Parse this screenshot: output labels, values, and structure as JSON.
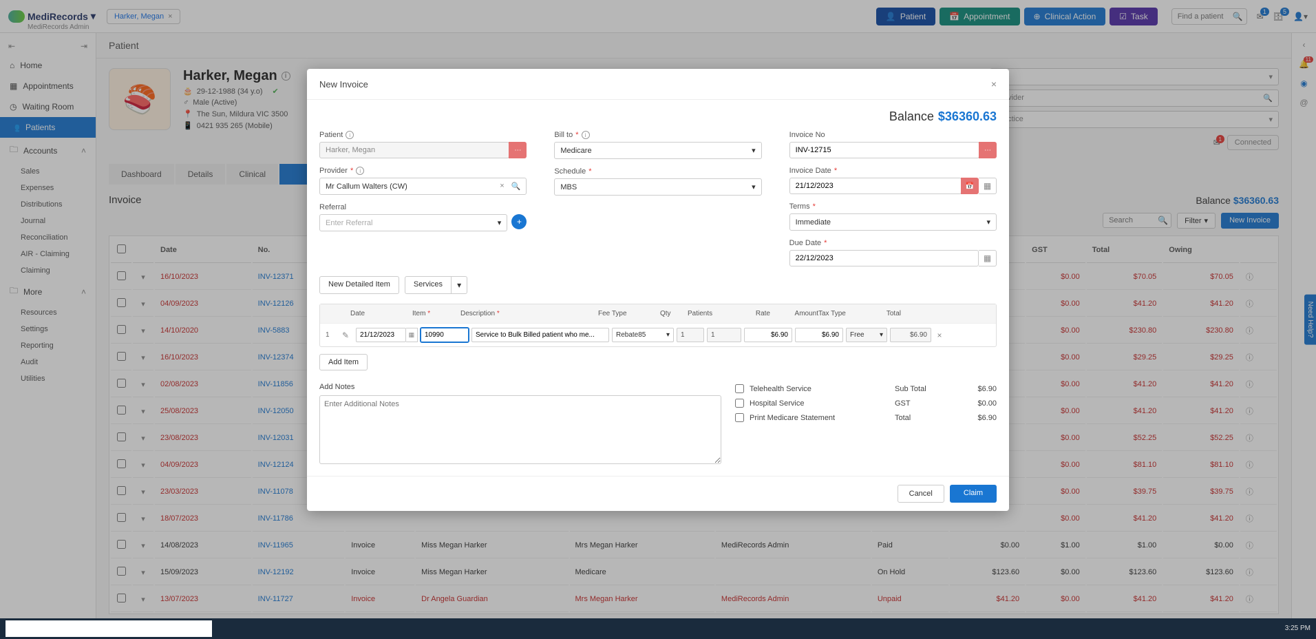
{
  "app": {
    "name": "MediRecords",
    "sub": "MediRecords Admin"
  },
  "patient_tab": "Harker, Megan",
  "top_buttons": {
    "patient": "Patient",
    "appointment": "Appointment",
    "clinical": "Clinical Action",
    "task": "Task"
  },
  "search_placeholder": "Find a patient",
  "badges": {
    "mail": "1",
    "box": "5",
    "rail": "11",
    "mailred": "1"
  },
  "sidebar": {
    "items": [
      {
        "label": "Home",
        "icon": "home"
      },
      {
        "label": "Appointments",
        "icon": "calendar"
      },
      {
        "label": "Waiting Room",
        "icon": "clock"
      },
      {
        "label": "Patients",
        "icon": "users",
        "active": true
      },
      {
        "label": "Accounts",
        "icon": "folder",
        "expand": true
      },
      {
        "label": "More",
        "icon": "folder",
        "expand": true
      }
    ],
    "accounts_sub": [
      "Sales",
      "Expenses",
      "Distributions",
      "Journal",
      "Reconciliation",
      "AIR - Claiming",
      "Claiming"
    ],
    "more_sub": [
      "Resources",
      "Settings",
      "Reporting",
      "Audit",
      "Utilities"
    ]
  },
  "page_title": "Patient",
  "patient": {
    "name": "Harker, Megan",
    "dob": "29-12-1988 (34 y.o)",
    "gender": "Male (Active)",
    "address": "The Sun, Mildura VIC 3500",
    "phone": "0421 935 265 (Mobile)"
  },
  "right_selects": {
    "a": "",
    "a_hint": "...rd",
    "b": "Provider",
    "c": "Practice"
  },
  "connected": "Connected",
  "tabs": [
    "Dashboard",
    "Details",
    "Clinical"
  ],
  "invoice": {
    "title": "Invoice",
    "balance_label": "Balance",
    "balance": "$36360.63",
    "search_ph": "Search",
    "filter": "Filter",
    "new": "New Invoice",
    "headers": [
      "Date",
      "No.",
      "",
      "",
      "",
      "",
      "",
      "",
      "GST",
      "Total",
      "Owing"
    ],
    "rows": [
      {
        "date": "16/10/2023",
        "no": "INV-12371",
        "gst": "$0.00",
        "total": "$70.05",
        "owing": "$70.05",
        "red": true
      },
      {
        "date": "04/09/2023",
        "no": "INV-12126",
        "gst": "$0.00",
        "total": "$41.20",
        "owing": "$41.20",
        "red": true
      },
      {
        "date": "14/10/2020",
        "no": "INV-5883",
        "gst": "$0.00",
        "total": "$230.80",
        "owing": "$230.80",
        "red": true
      },
      {
        "date": "16/10/2023",
        "no": "INV-12374",
        "gst": "$0.00",
        "total": "$29.25",
        "owing": "$29.25",
        "red": true
      },
      {
        "date": "02/08/2023",
        "no": "INV-11856",
        "gst": "$0.00",
        "total": "$41.20",
        "owing": "$41.20",
        "red": true
      },
      {
        "date": "25/08/2023",
        "no": "INV-12050",
        "gst": "$0.00",
        "total": "$41.20",
        "owing": "$41.20",
        "red": true
      },
      {
        "date": "23/08/2023",
        "no": "INV-12031",
        "gst": "$0.00",
        "total": "$52.25",
        "owing": "$52.25",
        "red": true
      },
      {
        "date": "04/09/2023",
        "no": "INV-12124",
        "gst": "$0.00",
        "total": "$81.10",
        "owing": "$81.10",
        "red": true
      },
      {
        "date": "23/03/2023",
        "no": "INV-11078",
        "gst": "$0.00",
        "total": "$39.75",
        "owing": "$39.75",
        "red": true
      },
      {
        "date": "18/07/2023",
        "no": "INV-11786",
        "gst": "$0.00",
        "total": "$41.20",
        "owing": "$41.20",
        "red": true
      },
      {
        "date": "14/08/2023",
        "no": "INV-11965",
        "type": "Invoice",
        "patient": "Miss Megan Harker",
        "payer": "Mrs Megan Harker",
        "center": "MediRecords Admin",
        "status": "Paid",
        "amt": "$0.00",
        "gst": "$1.00",
        "total": "$1.00",
        "owing": "$0.00"
      },
      {
        "date": "15/09/2023",
        "no": "INV-12192",
        "type": "Invoice",
        "patient": "Miss Megan Harker",
        "payer": "Medicare",
        "center": "",
        "status": "On Hold",
        "amt": "$123.60",
        "gst": "$0.00",
        "total": "$123.60",
        "owing": "$123.60"
      },
      {
        "date": "13/07/2023",
        "no": "INV-11727",
        "type": "Invoice",
        "patient": "Dr Angela Guardian",
        "payer": "Mrs Megan Harker",
        "center": "MediRecords Admin",
        "status": "Unpaid",
        "amt": "$41.20",
        "gst": "$0.00",
        "total": "$41.20",
        "owing": "$41.20",
        "red": true
      }
    ]
  },
  "modal": {
    "title": "New Invoice",
    "balance_label": "Balance",
    "balance": "$36360.63",
    "labels": {
      "patient": "Patient",
      "billto": "Bill to",
      "invoiceno": "Invoice No",
      "provider": "Provider",
      "schedule": "Schedule",
      "invoicedate": "Invoice Date",
      "referral": "Referral",
      "terms": "Terms",
      "duedate": "Due Date"
    },
    "values": {
      "patient": "Harker, Megan",
      "billto": "Medicare",
      "invoiceno": "INV-12715",
      "provider": "Mr Callum Walters (CW)",
      "schedule": "MBS",
      "invoicedate": "21/12/2023",
      "referral_ph": "Enter Referral",
      "terms": "Immediate",
      "duedate": "22/12/2023"
    },
    "actions": {
      "newdetailed": "New Detailed Item",
      "services": "Services",
      "additem": "Add Item"
    },
    "item_headers": {
      "date": "Date",
      "item": "Item",
      "desc": "Description",
      "fee": "Fee Type",
      "qty": "Qty",
      "patients": "Patients",
      "rate": "Rate",
      "amount": "Amount",
      "tax": "Tax Type",
      "total": "Total"
    },
    "item": {
      "num": "1",
      "date": "21/12/2023",
      "item": "10990",
      "desc": "Service to Bulk Billed patient who me...",
      "fee": "Rebate85",
      "qty": "1",
      "patients": "1",
      "rate": "$6.90",
      "amount": "$6.90",
      "tax": "Free",
      "total": "$6.90"
    },
    "notes_label": "Add Notes",
    "notes_ph": "Enter Additional Notes",
    "checks": {
      "telehealth": "Telehealth Service",
      "hospital": "Hospital Service",
      "print": "Print Medicare Statement"
    },
    "totals": {
      "subtotal_l": "Sub Total",
      "subtotal": "$6.90",
      "gst_l": "GST",
      "gst": "$0.00",
      "total_l": "Total",
      "total": "$6.90"
    },
    "footer": {
      "cancel": "Cancel",
      "claim": "Claim"
    }
  },
  "help": "Need Help?",
  "clock": "3:25 PM"
}
